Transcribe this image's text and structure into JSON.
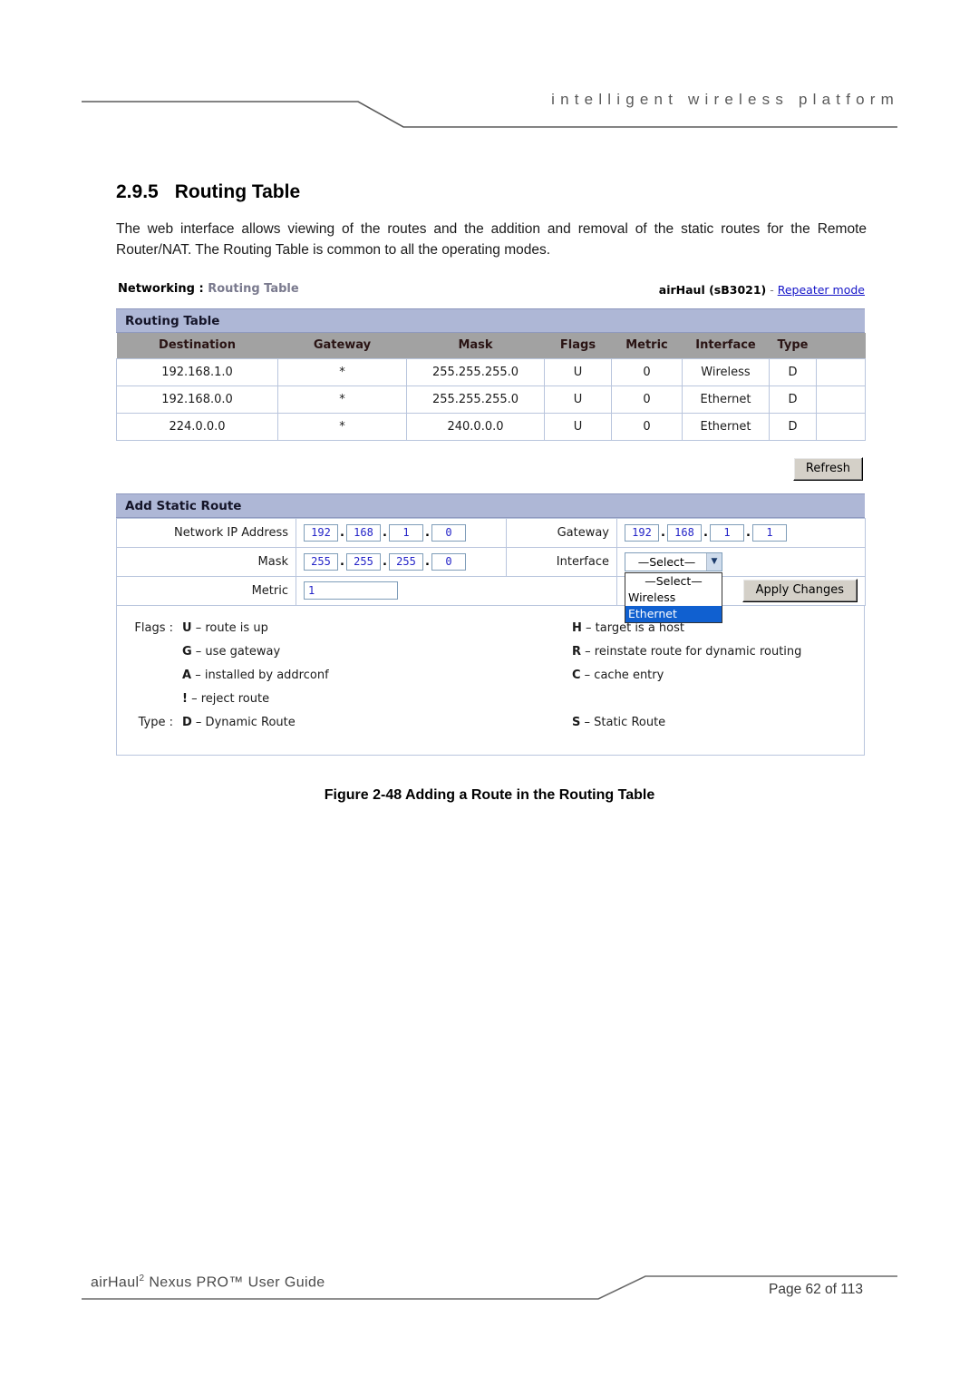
{
  "header": {
    "tagline": "intelligent   wireless   platform"
  },
  "section": {
    "number": "2.9.5",
    "title": "Routing Table",
    "paragraph": "The web interface allows viewing of the routes and the addition and removal of the static routes for the Remote Router/NAT. The Routing Table is common to all the operating modes."
  },
  "screenshot": {
    "breadcrumb_root": "Networking",
    "breadcrumb_sep": " : ",
    "breadcrumb_leaf": "Routing Table",
    "device_name": "airHaul (sB3021)",
    "device_dash": " - ",
    "device_mode": "Repeater mode",
    "routing_panel_title": "Routing Table",
    "columns": [
      "Destination",
      "Gateway",
      "Mask",
      "Flags",
      "Metric",
      "Interface",
      "Type",
      ""
    ],
    "rows": [
      [
        "192.168.1.0",
        "*",
        "255.255.255.0",
        "U",
        "0",
        "Wireless",
        "D",
        ""
      ],
      [
        "192.168.0.0",
        "*",
        "255.255.255.0",
        "U",
        "0",
        "Ethernet",
        "D",
        ""
      ],
      [
        "224.0.0.0",
        "*",
        "240.0.0.0",
        "U",
        "0",
        "Ethernet",
        "D",
        ""
      ]
    ],
    "refresh_label": "Refresh",
    "add_panel_title": "Add Static Route",
    "form": {
      "network_ip_label": "Network IP Address",
      "network_ip": [
        "192",
        "168",
        "1",
        "0"
      ],
      "gateway_label": "Gateway",
      "gateway": [
        "192",
        "168",
        "1",
        "1"
      ],
      "mask_label": "Mask",
      "mask": [
        "255",
        "255",
        "255",
        "0"
      ],
      "interface_label": "Interface",
      "interface_selected": "—Select—",
      "interface_options": [
        "—Select—",
        "Wireless",
        "Ethernet"
      ],
      "interface_highlighted": "Ethernet",
      "metric_label": "Metric",
      "metric": "1",
      "apply_label": "Apply Changes"
    },
    "legend": {
      "flags_key": "Flags :",
      "type_key": "Type :",
      "flags": [
        {
          "code": "U",
          "left": " – route is up",
          "rcode": "H",
          "right": " – target is a host"
        },
        {
          "code": "G",
          "left": " – use gateway",
          "rcode": "R",
          "right": " – reinstate route for dynamic routing"
        },
        {
          "code": "A",
          "left": " – installed by addrconf",
          "rcode": "C",
          "right": " – cache entry"
        },
        {
          "code": "!",
          "left": " – reject route",
          "rcode": "",
          "right": ""
        }
      ],
      "type": {
        "code": "D",
        "left": " – Dynamic Route",
        "rcode": "S",
        "right": " – Static Route"
      }
    }
  },
  "figure_caption": "Figure 2-48 Adding a Route in the Routing Table",
  "footer": {
    "left_pre": "airHaul",
    "left_sup": "2",
    "left_post": " Nexus PRO™ User Guide",
    "right": "Page 62 of 113"
  },
  "colors": {
    "panel_title_bg": "#aeb7d6",
    "column_header_bg": "#a2a2a2",
    "link": "#1414c8",
    "input_text": "#2424c8",
    "select_highlight": "#1060d0",
    "cell_border": "#b9c5dd"
  }
}
